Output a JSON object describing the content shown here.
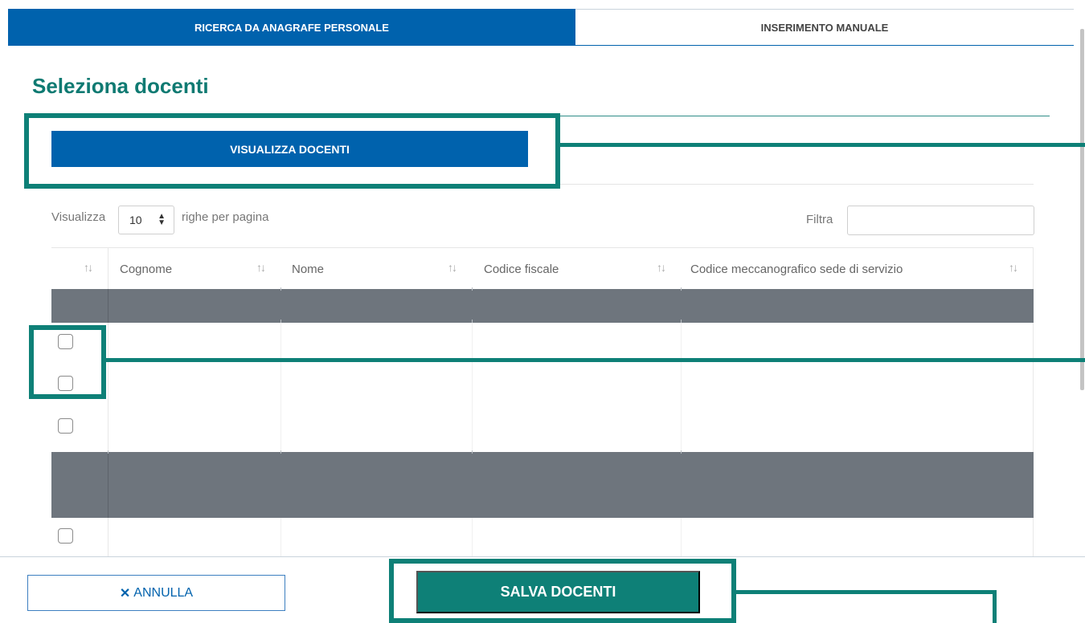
{
  "tabs": [
    {
      "label": "RICERCA DA ANAGRAFE PERSONALE",
      "active": true
    },
    {
      "label": "INSERIMENTO MANUALE",
      "active": false
    }
  ],
  "page_title": "Seleziona docenti",
  "visualizza_button": "VISUALIZZA DOCENTI",
  "length_control": {
    "prefix": "Visualizza",
    "value": "10",
    "suffix": "righe per pagina"
  },
  "filter": {
    "label": "Filtra",
    "value": ""
  },
  "table": {
    "sort_icon": "↑↓",
    "columns": [
      "Cognome",
      "Nome",
      "Codice fiscale",
      "Codice meccanografico sede di servizio"
    ],
    "visible_checkboxes": 4
  },
  "footer": {
    "cancel_icon": "✕",
    "cancel_label": "ANNULLA",
    "save_label": "SALVA DOCENTI"
  },
  "colors": {
    "primary_blue": "#0062ad",
    "teal": "#0e8077",
    "band_gray": "#6e757d"
  }
}
